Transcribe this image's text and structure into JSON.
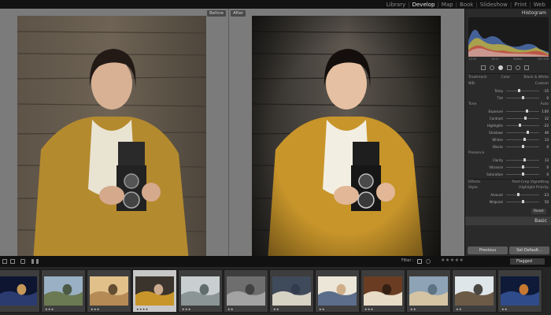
{
  "modules": [
    "Library",
    "Develop",
    "Map",
    "Book",
    "Slideshow",
    "Print",
    "Web"
  ],
  "active_module": "Develop",
  "center": {
    "before_label": "Before",
    "after_label": "After"
  },
  "right_panel": {
    "histogram_title": "Histogram",
    "histogram_readout": [
      "1/125",
      "f/2.8",
      "50mm",
      "ISO 200"
    ],
    "treatment": {
      "label": "Treatment:",
      "color": "Color",
      "bw": "Black & White"
    },
    "wb": {
      "label": "WB:",
      "value": "Custom"
    },
    "tone": {
      "label": "Tone",
      "auto": "Auto"
    },
    "presence": {
      "label": "Presence"
    },
    "sliders_wb": [
      {
        "label": "Temp",
        "value": "-15",
        "pos": 0.4
      },
      {
        "label": "Tint",
        "value": "0",
        "pos": 0.5
      }
    ],
    "sliders_tone": [
      {
        "label": "Exposure",
        "value": "1.00",
        "pos": 0.62
      },
      {
        "label": "Contrast",
        "value": "32",
        "pos": 0.58
      },
      {
        "label": "Highlights",
        "value": "-22",
        "pos": 0.42
      },
      {
        "label": "Shadows",
        "value": "46",
        "pos": 0.66
      },
      {
        "label": "Whites",
        "value": "13",
        "pos": 0.55
      },
      {
        "label": "Blacks",
        "value": "0",
        "pos": 0.5
      }
    ],
    "sliders_presence": [
      {
        "label": "Clarity",
        "value": "13",
        "pos": 0.55
      },
      {
        "label": "Vibrance",
        "value": "0",
        "pos": 0.5
      },
      {
        "label": "Saturation",
        "value": "0",
        "pos": 0.5
      }
    ],
    "effects_label": "Effects",
    "vignette_label": "Post-Crop Vignetting",
    "style_label": "Style:",
    "style_value": "Highlight Priority",
    "sliders_effects": [
      {
        "label": "Amount",
        "value": "-23",
        "pos": 0.38
      },
      {
        "label": "Midpoint",
        "value": "50",
        "pos": 0.5
      },
      {
        "label": "Roundness",
        "value": "0",
        "pos": 0.5
      },
      {
        "label": "Feather",
        "value": "50",
        "pos": 0.5
      },
      {
        "label": "Highlights",
        "value": "0",
        "pos": 0.5
      }
    ],
    "reset_button": "Reset",
    "basic_title": "Basic",
    "previous_button": "Previous",
    "set_default_button": "Set Default..."
  },
  "filmbar": {
    "filter_label": "Filter :",
    "flag_value": "Flagged"
  },
  "filmstrip": [
    {
      "stars": "",
      "scene": "night"
    },
    {
      "stars": "★★★",
      "scene": "hills"
    },
    {
      "stars": "★★★",
      "scene": "sunset"
    },
    {
      "stars": "★★★★",
      "scene": "portrait"
    },
    {
      "stars": "★★★",
      "scene": "fog"
    },
    {
      "stars": "★★",
      "scene": "bridge"
    },
    {
      "stars": "★★",
      "scene": "kids"
    },
    {
      "stars": "★★",
      "scene": "boy"
    },
    {
      "stars": "★★★",
      "scene": "cafe"
    },
    {
      "stars": "★★",
      "scene": "coast"
    },
    {
      "stars": "★★",
      "scene": "trees"
    },
    {
      "stars": "★★",
      "scene": "city"
    }
  ]
}
